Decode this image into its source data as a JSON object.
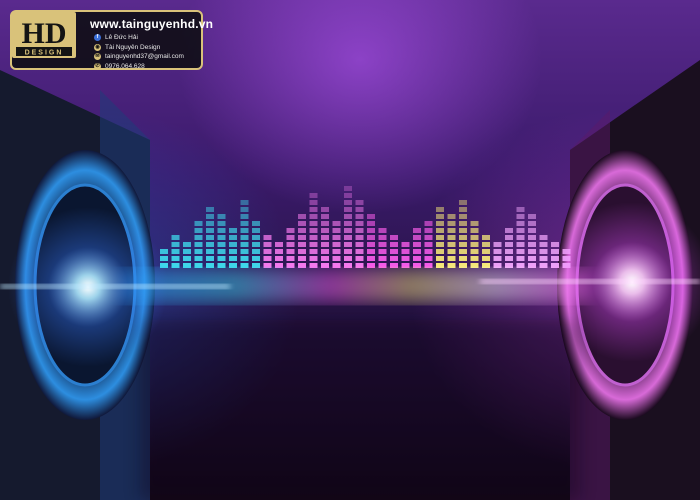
{
  "badge": {
    "site": "www.tainguyenhd.vn",
    "logo_letters": "HD",
    "logo_sub": "DESIGN",
    "contacts": [
      {
        "icon": "facebook-icon",
        "text": "Lê Đức Hải"
      },
      {
        "icon": "page-icon",
        "text": "Tài Nguyên Design"
      },
      {
        "icon": "mail-icon",
        "text": "tainguyenhd37@gmail.com"
      },
      {
        "icon": "phone-icon",
        "text": "0976.064.628"
      }
    ]
  },
  "colors": {
    "accent_gold": "#d9c27a",
    "wave_cyan": "#3fe0f0",
    "wave_magenta": "#ff5ef0",
    "wave_yellow": "#fff27a",
    "bg_purple": "#5a2a8e"
  }
}
